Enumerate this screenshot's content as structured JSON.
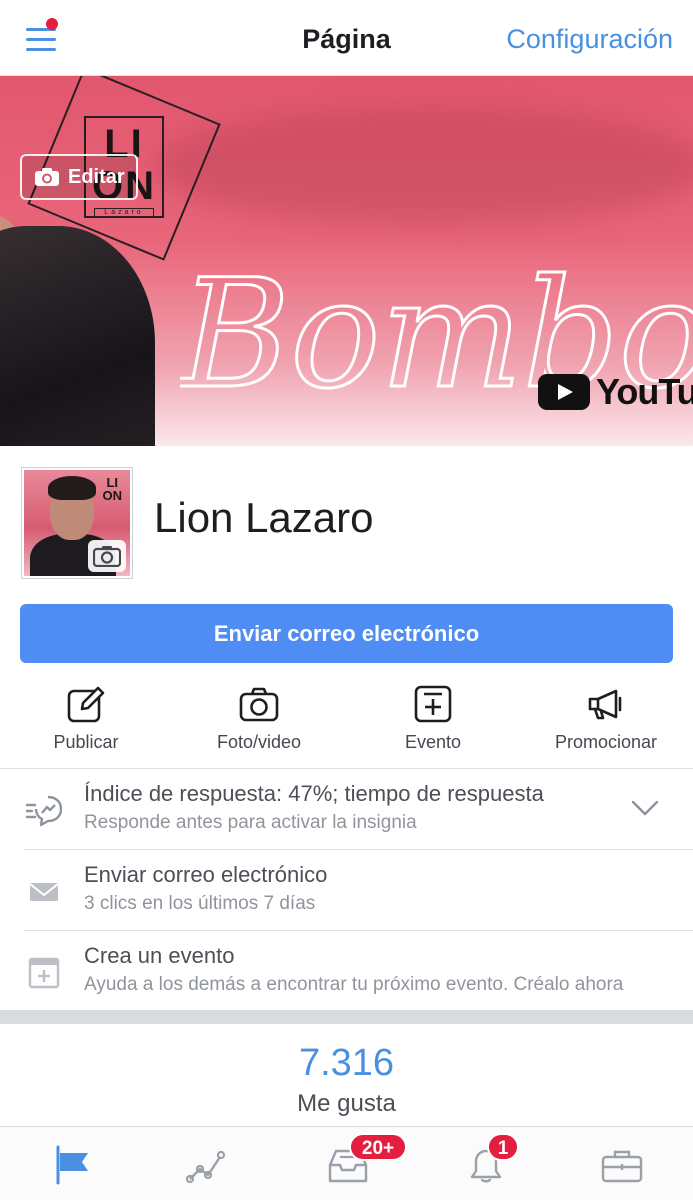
{
  "header": {
    "title": "Página",
    "settings_label": "Configuración",
    "menu_icon": "hamburger-menu-icon",
    "notification_dot_color": "#e41e3f"
  },
  "cover": {
    "edit_label": "Editar",
    "logo_line1": "LI",
    "logo_line2": "ON",
    "logo_sub": "Lázaro",
    "script_text": "Bombona",
    "youtube_text": "YouTube"
  },
  "profile": {
    "name": "Lion Lazaro",
    "avatar_logo": "LI\nON"
  },
  "primary_button": {
    "label": "Enviar correo electrónico",
    "color": "#4f8cf4"
  },
  "actions": [
    {
      "label": "Publicar",
      "icon": "edit-icon"
    },
    {
      "label": "Foto/video",
      "icon": "camera-icon"
    },
    {
      "label": "Evento",
      "icon": "event-icon"
    },
    {
      "label": "Promocionar",
      "icon": "megaphone-icon"
    }
  ],
  "insights": [
    {
      "title": "Índice de respuesta: 47%; tiempo de respuesta",
      "subtitle": "Responde antes para activar la insignia",
      "icon": "messenger-bolt-icon"
    },
    {
      "title": "Enviar correo electrónico",
      "subtitle": "3 clics en los últimos 7 días",
      "icon": "envelope-icon"
    },
    {
      "title": "Crea un evento",
      "subtitle": "Ayuda a los demás a encontrar tu próximo evento. Créalo ahora",
      "icon": "calendar-add-icon"
    }
  ],
  "likes": {
    "count": "7.316",
    "label": "Me gusta"
  },
  "tabbar": {
    "tabs": [
      "page-flag-icon",
      "insights-chart-icon",
      "inbox-icon",
      "notifications-bell-icon",
      "briefcase-icon"
    ],
    "inbox_badge": "20+",
    "notifications_badge": "1",
    "active_color": "#4a90e2"
  }
}
